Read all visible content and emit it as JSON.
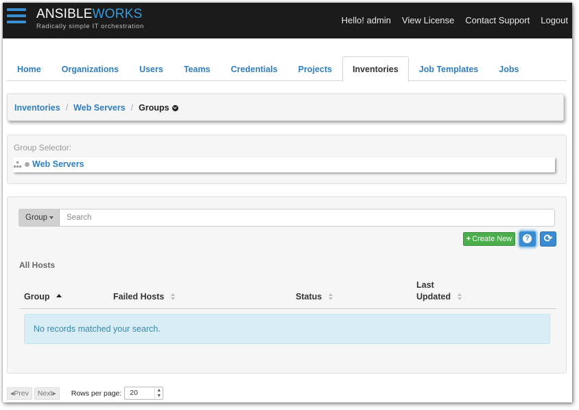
{
  "header": {
    "brand_name_a": "ANSIBLE",
    "brand_name_b": "WORKS",
    "tagline": "Radically simple IT orchestration",
    "nav": [
      "Hello! admin",
      "View License",
      "Contact Support",
      "Logout"
    ]
  },
  "tabs": [
    {
      "label": "Home"
    },
    {
      "label": "Organizations"
    },
    {
      "label": "Users"
    },
    {
      "label": "Teams"
    },
    {
      "label": "Credentials"
    },
    {
      "label": "Projects"
    },
    {
      "label": "Inventories",
      "active": true
    },
    {
      "label": "Job Templates"
    },
    {
      "label": "Jobs"
    }
  ],
  "breadcrumb": {
    "items": [
      "Inventories",
      "Web Servers"
    ],
    "current": "Groups"
  },
  "group_selector": {
    "label": "Group Selector:",
    "selected": "Web Servers"
  },
  "search": {
    "filter_label": "Group",
    "placeholder": "Search"
  },
  "actions": {
    "create_label": "Create New",
    "help_glyph": "?"
  },
  "table": {
    "title": "All Hosts",
    "columns": [
      "Group",
      "Failed Hosts",
      "Status",
      "Last Updated"
    ],
    "sorted_column": "Group",
    "empty_message": "No records matched your search."
  },
  "pagination": {
    "prev_label": "Prev",
    "next_label": "Next",
    "rows_label": "Rows per page:",
    "rows_value": "20"
  },
  "colors": {
    "topbar": "#1b1b1b",
    "accent": "#2f7ec0",
    "create_green": "#4cae4c",
    "info_bg": "#d9edf7"
  }
}
